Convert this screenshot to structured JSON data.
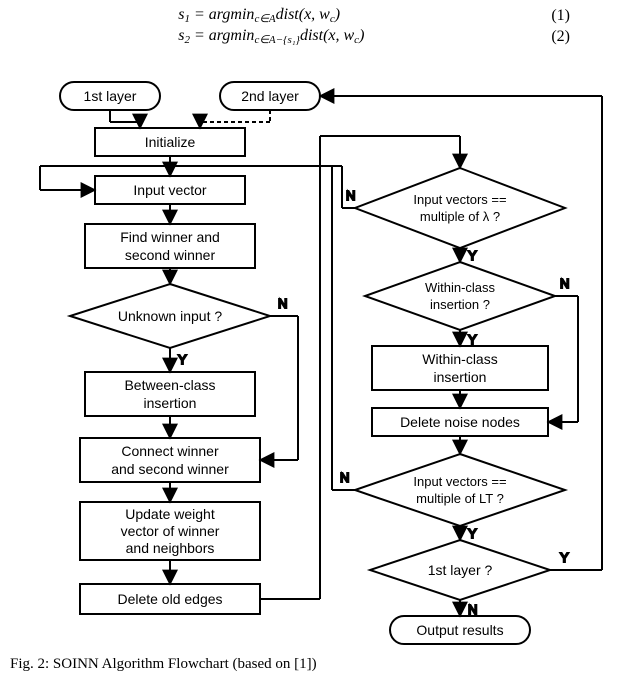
{
  "equations": {
    "s1_lhs": "s",
    "s1_sub": "1",
    "s1_body": " = argmin",
    "s1_cond": "c∈A",
    "s1_tail": "dist(x, w",
    "s1_tail_sub": "c",
    "s1_close": ")",
    "s1_num": "(1)",
    "s2_lhs": "s",
    "s2_sub": "2",
    "s2_body": " = argmin",
    "s2_cond": "c∈A−{s₁}",
    "s2_tail": "dist(x, w",
    "s2_tail_sub": "c",
    "s2_close": ")",
    "s2_num": "(2)"
  },
  "nodes": {
    "first_layer": "1st layer",
    "second_layer": "2nd layer",
    "initialize": "Initialize",
    "input_vector": "Input vector",
    "find_winner_l1": "Find winner and",
    "find_winner_l2": "second winner",
    "unknown_input": "Unknown input ?",
    "between_insert_l1": "Between-class",
    "between_insert_l2": "insertion",
    "connect_l1": "Connect winner",
    "connect_l2": "and second winner",
    "update_l1": "Update weight",
    "update_l2": "vector of winner",
    "update_l3": "and neighbors",
    "delete_old": "Delete old edges",
    "mult_lambda_l1": "Input vectors ==",
    "mult_lambda_l2": "multiple of λ ?",
    "within_q_l1": "Within-class",
    "within_q_l2": "insertion ?",
    "within_ins_l1": "Within-class",
    "within_ins_l2": "insertion",
    "delete_noise": "Delete noise nodes",
    "mult_lt_l1": "Input vectors ==",
    "mult_lt_l2": "multiple of LT ?",
    "first_layer_q": "1st layer ?",
    "output": "Output results"
  },
  "labels": {
    "Y": "Y",
    "N": "N"
  },
  "caption": "Fig.  2: SOINN Algorithm Flowchart (based on [1])"
}
